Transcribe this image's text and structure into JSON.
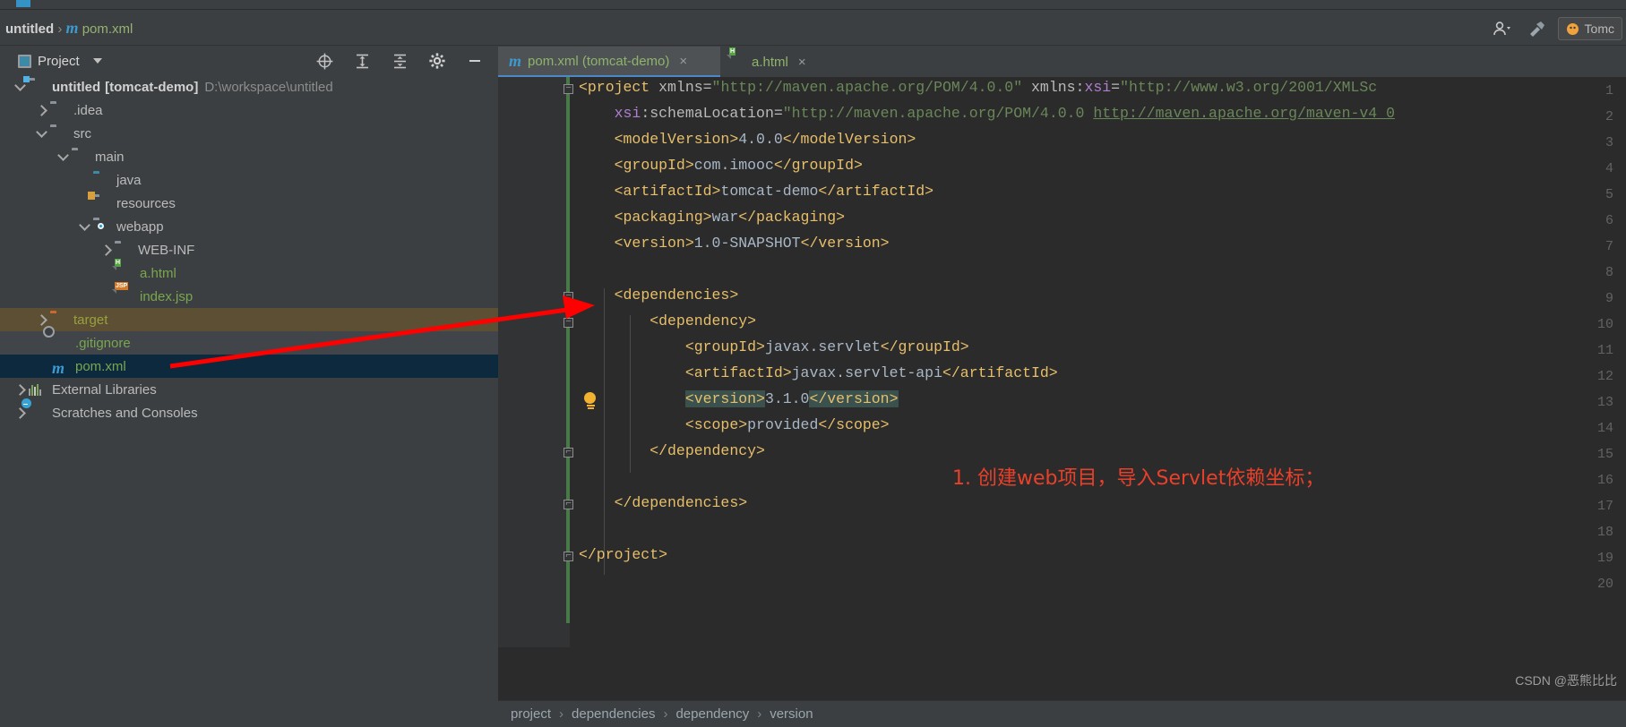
{
  "window": {
    "breadcrumb_project": "untitled",
    "breadcrumb_file": "pom.xml",
    "maven_glyph": "m",
    "separator": "›"
  },
  "toolbar_right": {
    "account_icon": "user-icon",
    "dropdown_icon": "chevron-down-icon",
    "build_icon": "hammer-icon",
    "run_config_label": "Tomc",
    "run_config_icon": "tomcat-icon"
  },
  "tool_window": {
    "title": "Project",
    "title_icon": "project-view-icon",
    "dropdown_icon": "chevron-down-icon",
    "actions": [
      {
        "name": "locate-icon",
        "glyph": "⊕"
      },
      {
        "name": "expand-all-icon",
        "glyph": "⤓"
      },
      {
        "name": "collapse-all-icon",
        "glyph": "⤒"
      },
      {
        "name": "settings-gear-icon",
        "glyph": "⚙"
      },
      {
        "name": "hide-icon",
        "glyph": "—"
      }
    ]
  },
  "project_tree": [
    {
      "id": "untitled",
      "label": "untitled",
      "bracket": "[tomcat-demo]",
      "path": "D:\\workspace\\untitled",
      "indent": 0,
      "toggle": "down",
      "icon": "module-folder-icon",
      "state": "none",
      "color": "bold"
    },
    {
      "id": "idea",
      "label": ".idea",
      "indent": 1,
      "toggle": "right",
      "icon": "folder-icon",
      "state": "none",
      "color": "normal"
    },
    {
      "id": "src",
      "label": "src",
      "indent": 1,
      "toggle": "down",
      "icon": "folder-icon",
      "state": "none",
      "color": "normal"
    },
    {
      "id": "main",
      "label": "main",
      "indent": 2,
      "toggle": "down",
      "icon": "folder-icon",
      "state": "none",
      "color": "normal"
    },
    {
      "id": "java",
      "label": "java",
      "indent": 3,
      "toggle": "none",
      "icon": "source-folder-icon",
      "state": "none",
      "color": "normal"
    },
    {
      "id": "resources",
      "label": "resources",
      "indent": 3,
      "toggle": "none",
      "icon": "resources-folder-icon",
      "state": "none",
      "color": "normal"
    },
    {
      "id": "webapp",
      "label": "webapp",
      "indent": 3,
      "toggle": "down",
      "icon": "webapp-folder-icon",
      "state": "none",
      "color": "normal"
    },
    {
      "id": "webinf",
      "label": "WEB-INF",
      "indent": 4,
      "toggle": "right",
      "icon": "folder-icon",
      "state": "none",
      "color": "normal"
    },
    {
      "id": "ahtml",
      "label": "a.html",
      "indent": 4,
      "toggle": "none",
      "icon": "html-file-icon",
      "state": "none",
      "color": "green"
    },
    {
      "id": "indexjsp",
      "label": "index.jsp",
      "indent": 4,
      "toggle": "none",
      "icon": "jsp-file-icon",
      "state": "none",
      "color": "green"
    },
    {
      "id": "target",
      "label": "target",
      "indent": 1,
      "toggle": "right",
      "icon": "excluded-folder-icon",
      "state": "target",
      "color": "olive"
    },
    {
      "id": "gitignore",
      "label": ".gitignore",
      "indent": 2,
      "toggle": "none",
      "icon": "gitignore-file-icon",
      "state": "grey",
      "color": "green"
    },
    {
      "id": "pomxml",
      "label": "pom.xml",
      "indent": 2,
      "toggle": "none",
      "icon": "maven-file-icon",
      "state": "blue",
      "color": "green"
    },
    {
      "id": "extlibs",
      "label": "External Libraries",
      "indent": 0,
      "toggle": "right",
      "icon": "libraries-icon",
      "state": "none",
      "color": "normal"
    },
    {
      "id": "scratches",
      "label": "Scratches and Consoles",
      "indent": 0,
      "toggle": "right",
      "icon": "scratches-icon",
      "state": "none",
      "color": "normal"
    }
  ],
  "editor_tabs": [
    {
      "id": "pom",
      "label": "pom.xml (tomcat-demo)",
      "icon": "maven-file-icon",
      "active": true,
      "close": "×"
    },
    {
      "id": "ahtml",
      "label": "a.html",
      "icon": "html-file-icon",
      "active": false,
      "close": "×"
    }
  ],
  "code": {
    "first_line": 1,
    "last_line": 20,
    "lines": [
      {
        "n": 1,
        "fold": "open",
        "text": "<project xmlns=\"http://maven.apache.org/POM/4.0.0\" xmlns:xsi=\"http://www.w3.org/2001/XMLSc"
      },
      {
        "n": 2,
        "fold": "",
        "text": "    xsi:schemaLocation=\"http://maven.apache.org/POM/4.0.0 http://maven.apache.org/maven-v4_0"
      },
      {
        "n": 3,
        "fold": "",
        "text": "    <modelVersion>4.0.0</modelVersion>"
      },
      {
        "n": 4,
        "fold": "",
        "text": "    <groupId>com.imooc</groupId>"
      },
      {
        "n": 5,
        "fold": "",
        "text": "    <artifactId>tomcat-demo</artifactId>"
      },
      {
        "n": 6,
        "fold": "",
        "text": "    <packaging>war</packaging>"
      },
      {
        "n": 7,
        "fold": "",
        "text": "    <version>1.0-SNAPSHOT</version>"
      },
      {
        "n": 8,
        "fold": "",
        "text": ""
      },
      {
        "n": 9,
        "fold": "open",
        "text": "    <dependencies>"
      },
      {
        "n": 10,
        "fold": "open",
        "text": "        <dependency>"
      },
      {
        "n": 11,
        "fold": "",
        "text": "            <groupId>javax.servlet</groupId>"
      },
      {
        "n": 12,
        "fold": "",
        "text": "            <artifactId>javax.servlet-api</artifactId>"
      },
      {
        "n": 13,
        "fold": "",
        "text": "            <version>3.1.0</version>",
        "bulb": true,
        "highlighted": true
      },
      {
        "n": 14,
        "fold": "",
        "text": "            <scope>provided</scope>"
      },
      {
        "n": 15,
        "fold": "close",
        "text": "        </dependency>"
      },
      {
        "n": 16,
        "fold": "",
        "text": ""
      },
      {
        "n": 17,
        "fold": "close",
        "text": "    </dependencies>"
      },
      {
        "n": 18,
        "fold": "",
        "text": ""
      },
      {
        "n": 19,
        "fold": "close",
        "text": "</project>"
      },
      {
        "n": 20,
        "fold": "",
        "text": ""
      }
    ]
  },
  "annotation": {
    "text": "1. 创建web项目，导入Servlet依赖坐标；",
    "color": "#e8402a",
    "arrow_color": "#ff0000"
  },
  "watermark": {
    "text": "CSDN @恶熊比比"
  },
  "bottom_breadcrumb": {
    "separator": "›",
    "items": [
      "project",
      "dependencies",
      "dependency",
      "version"
    ]
  },
  "colors": {
    "editor_bg": "#2b2b2b",
    "panel_bg": "#3c3f41",
    "gutter_bg": "#313335",
    "selection_blue": "#0d293e",
    "selection_target": "#5c4f33",
    "accent_tab": "#4a88c7",
    "tag": "#e8bf6a",
    "string": "#6a8759",
    "text": "#a9b7c6",
    "namespace": "#b07fd1",
    "highlight": "#3b514d",
    "bulb": "#f2b231"
  }
}
